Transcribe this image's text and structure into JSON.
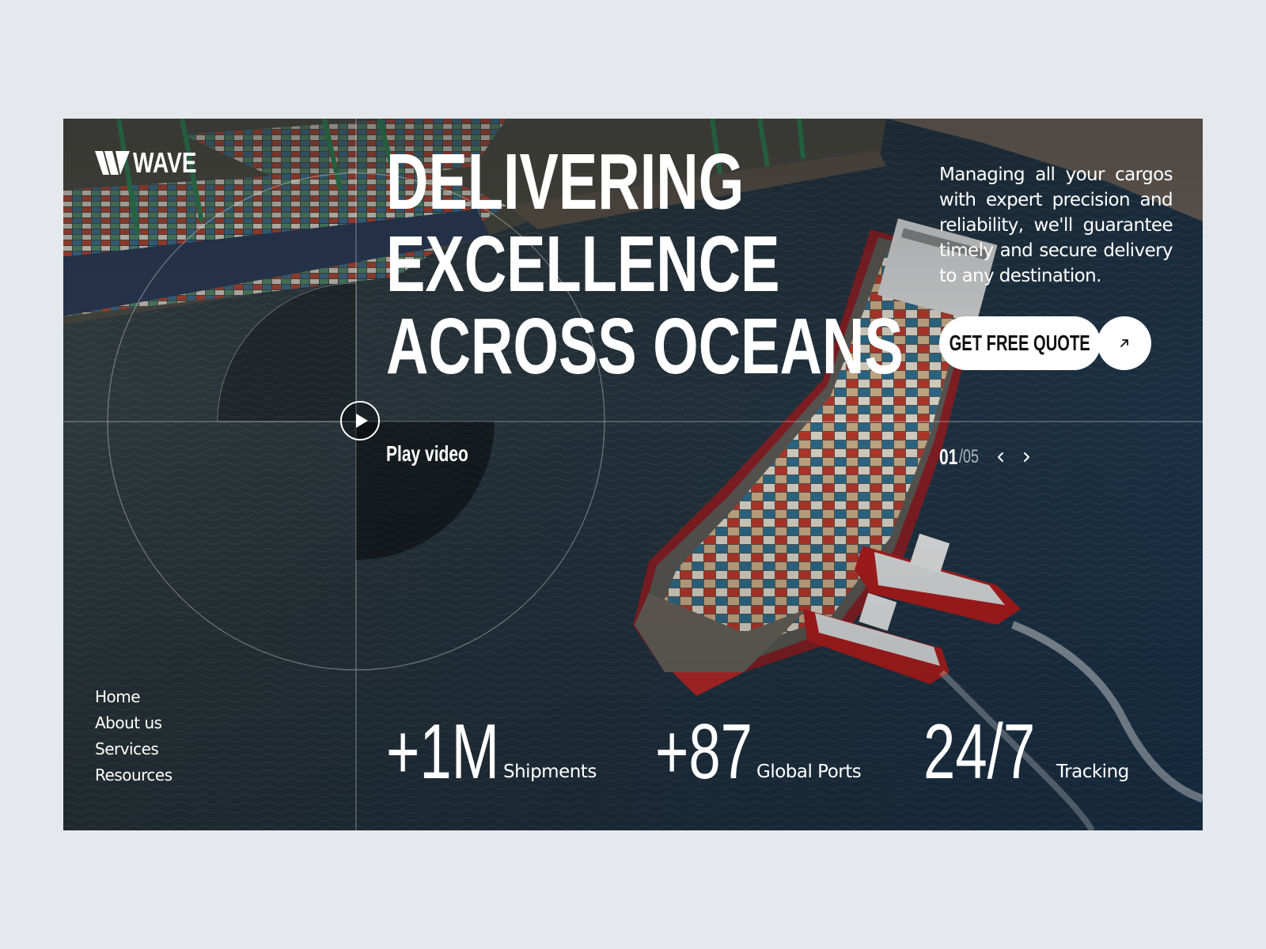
{
  "brand": {
    "name": "WAVE"
  },
  "hero": {
    "headline": [
      "DELIVERING",
      "EXCELLENCE",
      "ACROSS OCEANS"
    ],
    "tagline": "Managing all your cargos with expert precision and reliability, we'll guarantee timely and secure delivery to any destination.",
    "cta_label": "GET FREE QUOTE",
    "cta_icon": "arrow-up-right-icon",
    "play_label": "Play video"
  },
  "slider": {
    "current": "01",
    "total": "/05"
  },
  "nav": [
    "Home",
    "About us",
    "Services",
    "Resources"
  ],
  "stats": [
    {
      "value": "+1M",
      "label": "Shipments"
    },
    {
      "value": "+87",
      "label": "Global Ports"
    },
    {
      "value": "24/7",
      "label": "Tracking"
    }
  ],
  "colors": {
    "page_bg": "#e5e8ed",
    "text": "#ffffff",
    "button_bg": "#ffffff",
    "button_text": "#111111"
  }
}
